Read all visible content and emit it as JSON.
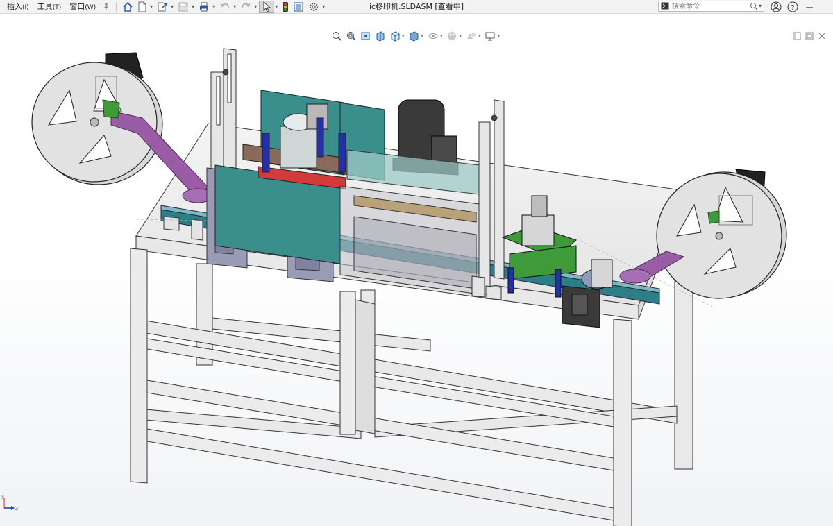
{
  "menubar": {
    "items": [
      {
        "label": "插入",
        "accel": "(I)"
      },
      {
        "label": "工具",
        "accel": "(T)"
      },
      {
        "label": "窗口",
        "accel": "(W)"
      }
    ]
  },
  "document": {
    "title": "ic移印机.SLDASM [查看中]"
  },
  "search": {
    "placeholder": "搜索命令"
  },
  "triad": {
    "x_label": "X",
    "z_label": "Z"
  },
  "colors": {
    "toolbar_bg": "#f3f3f3",
    "frame_steel": "#e6e6e6",
    "teal_plate": "#3a8f8c",
    "purple_arm": "#9a5ca6",
    "green_plate": "#3f9a3a",
    "blue_cylinder": "#2430a8",
    "motor_dark": "#3a3a3a",
    "brass": "#b9a27a"
  },
  "icons": {
    "toolbar": [
      "pin-icon",
      "home-icon",
      "new-document-icon",
      "open-icon",
      "save-icon",
      "print-icon",
      "undo-icon",
      "redo-icon",
      "select-arrow-icon",
      "rebuild-traffic-light-icon",
      "file-properties-icon",
      "options-gear-icon"
    ],
    "heads_up": [
      "zoom-to-fit-icon",
      "zoom-to-area-icon",
      "previous-view-icon",
      "section-view-icon",
      "view-orientation-icon",
      "display-style-icon",
      "hide-show-icon",
      "edit-appearance-icon",
      "apply-scene-icon",
      "view-settings-icon"
    ],
    "right": [
      "search-icon",
      "user-icon",
      "help-icon",
      "minimize-icon"
    ]
  }
}
